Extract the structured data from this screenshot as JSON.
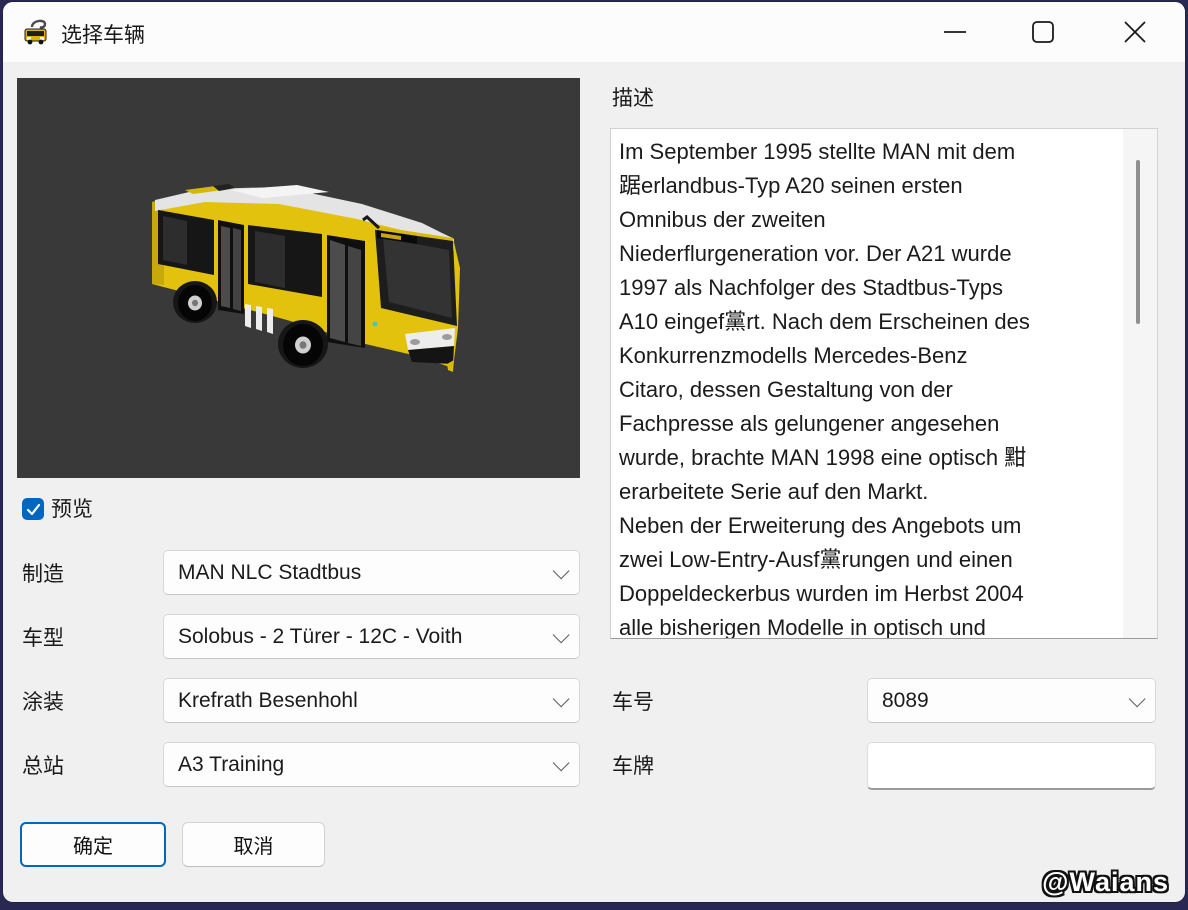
{
  "window": {
    "title": "选择车辆",
    "controls": {
      "minimize": "minimize",
      "maximize": "maximize",
      "close": "close"
    }
  },
  "preview": {
    "checkbox_label": "预览",
    "checked": true,
    "image_alt": "yellow-black MAN city bus 3d preview on dark gray background"
  },
  "form": {
    "manufacturer": {
      "label": "制造",
      "value": "MAN NLC Stadtbus"
    },
    "model": {
      "label": "车型",
      "value": "Solobus - 2 Türer - 12C - Voith"
    },
    "livery": {
      "label": "涂装",
      "value": "Krefrath Besenhohl"
    },
    "depot": {
      "label": "总站",
      "value": "A3 Training"
    },
    "fleet_number": {
      "label": "车号",
      "value": "8089"
    },
    "license_plate": {
      "label": "车牌",
      "value": ""
    }
  },
  "description": {
    "label": "描述",
    "text": "Im September 1995 stellte MAN mit dem\n踞erlandbus-Typ A20 seinen ersten\nOmnibus der zweiten\nNiederflurgeneration vor. Der A21 wurde\n1997 als Nachfolger des Stadtbus-Typs\nA10 eingef黨rt. Nach dem Erscheinen des\nKonkurrenzmodells Mercedes-Benz\nCitaro, dessen Gestaltung von der\nFachpresse als gelungener angesehen\nwurde, brachte MAN 1998 eine optisch 黚\nerarbeitete Serie auf den Markt.\nNeben der Erweiterung des Angebots um\nzwei Low-Entry-Ausf黨rungen und einen\nDoppeldeckerbus wurden im Herbst 2004\nalle bisherigen Modelle in optisch und"
  },
  "buttons": {
    "ok": "确定",
    "cancel": "取消"
  },
  "watermark": "@Waians",
  "colors": {
    "accent": "#0067c0",
    "window_outer": "#282852",
    "titlebar": "#fcfcfc",
    "body": "#f0f0f0",
    "preview_background": "#393939",
    "bus_yellow": "#e3c20e",
    "scroll_thumb": "#8f8f8f"
  }
}
